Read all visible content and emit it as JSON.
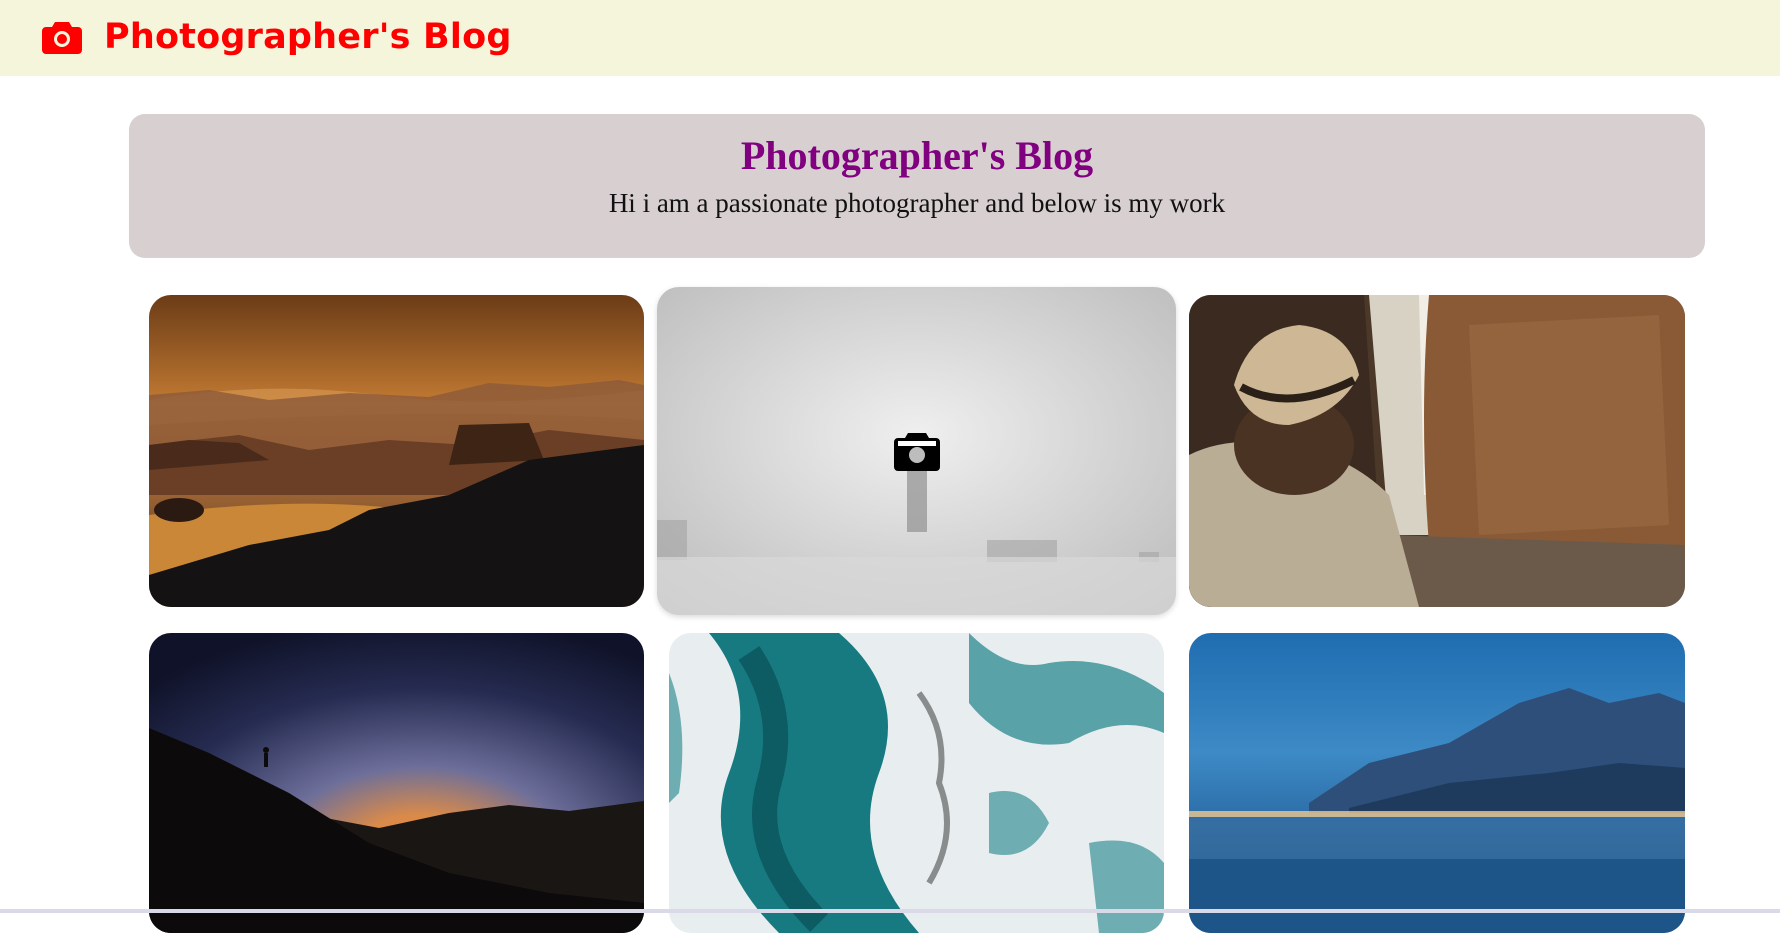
{
  "header": {
    "brand_icon": "camera-icon",
    "brand_title": "Photographer's Blog",
    "brand_color": "#ff0000",
    "background": "#f5f5dc"
  },
  "hero": {
    "title": "Photographer's Blog",
    "subtitle": "Hi i am a passionate photographer and below is my work",
    "title_color": "#800080",
    "background": "#d7cfd0"
  },
  "gallery": {
    "photos": [
      {
        "subject": "desert-sunset-photo"
      },
      {
        "subject": "foggy-tower-photo",
        "hover_icon": "camera-icon"
      },
      {
        "subject": "hat-canyon-photo"
      },
      {
        "subject": "hiker-dusk-photo"
      },
      {
        "subject": "ocean-waves-aerial-photo"
      },
      {
        "subject": "lake-night-town-photo"
      }
    ]
  }
}
